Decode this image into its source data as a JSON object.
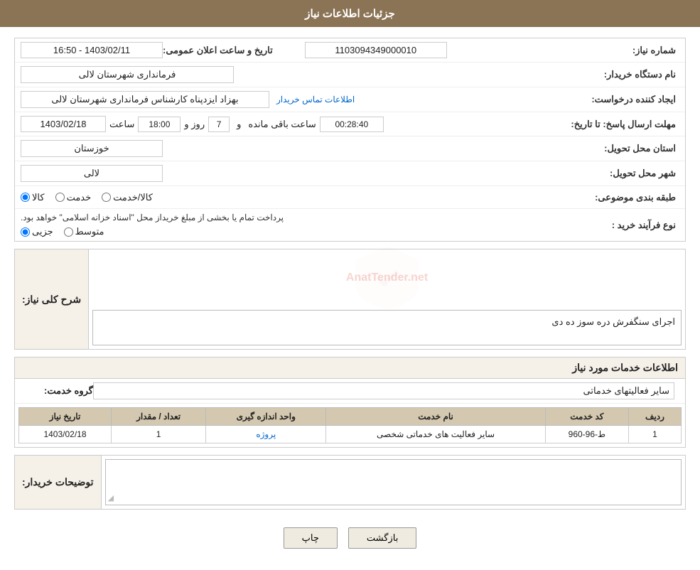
{
  "header": {
    "title": "جزئیات اطلاعات نیاز"
  },
  "form": {
    "fields": {
      "shomara_niaz_label": "شماره نیاز:",
      "shomara_niaz_value": "1103094349000010",
      "nam_dastgah_label": "نام دستگاه خریدار:",
      "nam_dastgah_value": "فرمانداری شهرستان لالی",
      "ejad_label": "ایجاد کننده درخواست:",
      "ejad_value": "بهزاد ایزدپناه کارشناس فرمانداری شهرستان لالی",
      "ejad_link": "اطلاعات تماس خریدار",
      "tarikh_ersal_label": "مهلت ارسال پاسخ: تا تاریخ:",
      "tarikh_ersal_date": "1403/02/18",
      "tarikh_ersal_saat_label": "ساعت",
      "tarikh_ersal_saat": "18:00",
      "tarikh_ersal_roz_label": "روز و",
      "tarikh_ersal_roz": "7",
      "tarikh_ersal_baqi_label": "ساعت باقی مانده",
      "tarikh_ersal_baqi": "00:28:40",
      "ostan_label": "استان محل تحویل:",
      "ostan_value": "خوزستان",
      "shahr_label": "شهر محل تحویل:",
      "shahr_value": "لالی",
      "tabaghe_label": "طبقه بندی موضوعی:",
      "tabaghe_kala": "کالا",
      "tabaghe_khedmat": "خدمت",
      "tabaghe_kala_khedmat": "کالا/خدمت",
      "tarikh_elan_label": "تاریخ و ساعت اعلان عمومی:",
      "tarikh_elan_value": "1403/02/11 - 16:50",
      "nooe_farayand_label": "نوع فرآیند خرید :",
      "nooe_jozi": "جزیی",
      "nooe_motevaset": "متوسط",
      "nooe_text": "پرداخت تمام یا بخشی از مبلغ خریداز محل \"اسناد خزانه اسلامی\" خواهد بود.",
      "sharh_label": "شرح کلی نیاز:",
      "sharh_value": "اجرای سنگفرش دره سوز ده دی",
      "info_services_title": "اطلاعات خدمات مورد نیاز",
      "grooh_khedmat_label": "گروه خدمت:",
      "grooh_khedmat_value": "سایر فعالیتهای خدماتی",
      "table": {
        "headers": [
          "ردیف",
          "کد خدمت",
          "نام خدمت",
          "واحد اندازه گیری",
          "تعداد / مقدار",
          "تاریخ نیاز"
        ],
        "rows": [
          {
            "radif": "1",
            "kod_khedmat": "ط-96-960",
            "nam_khedmat": "سایر فعالیت های خدماتی شخصی",
            "vahed": "پروژه",
            "tedad": "1",
            "tarikh": "1403/02/18"
          }
        ]
      },
      "tosihaat_label": "توضیحات خریدار:",
      "tosihaat_value": ""
    },
    "buttons": {
      "chap": "چاپ",
      "bazgasht": "بازگشت"
    }
  }
}
